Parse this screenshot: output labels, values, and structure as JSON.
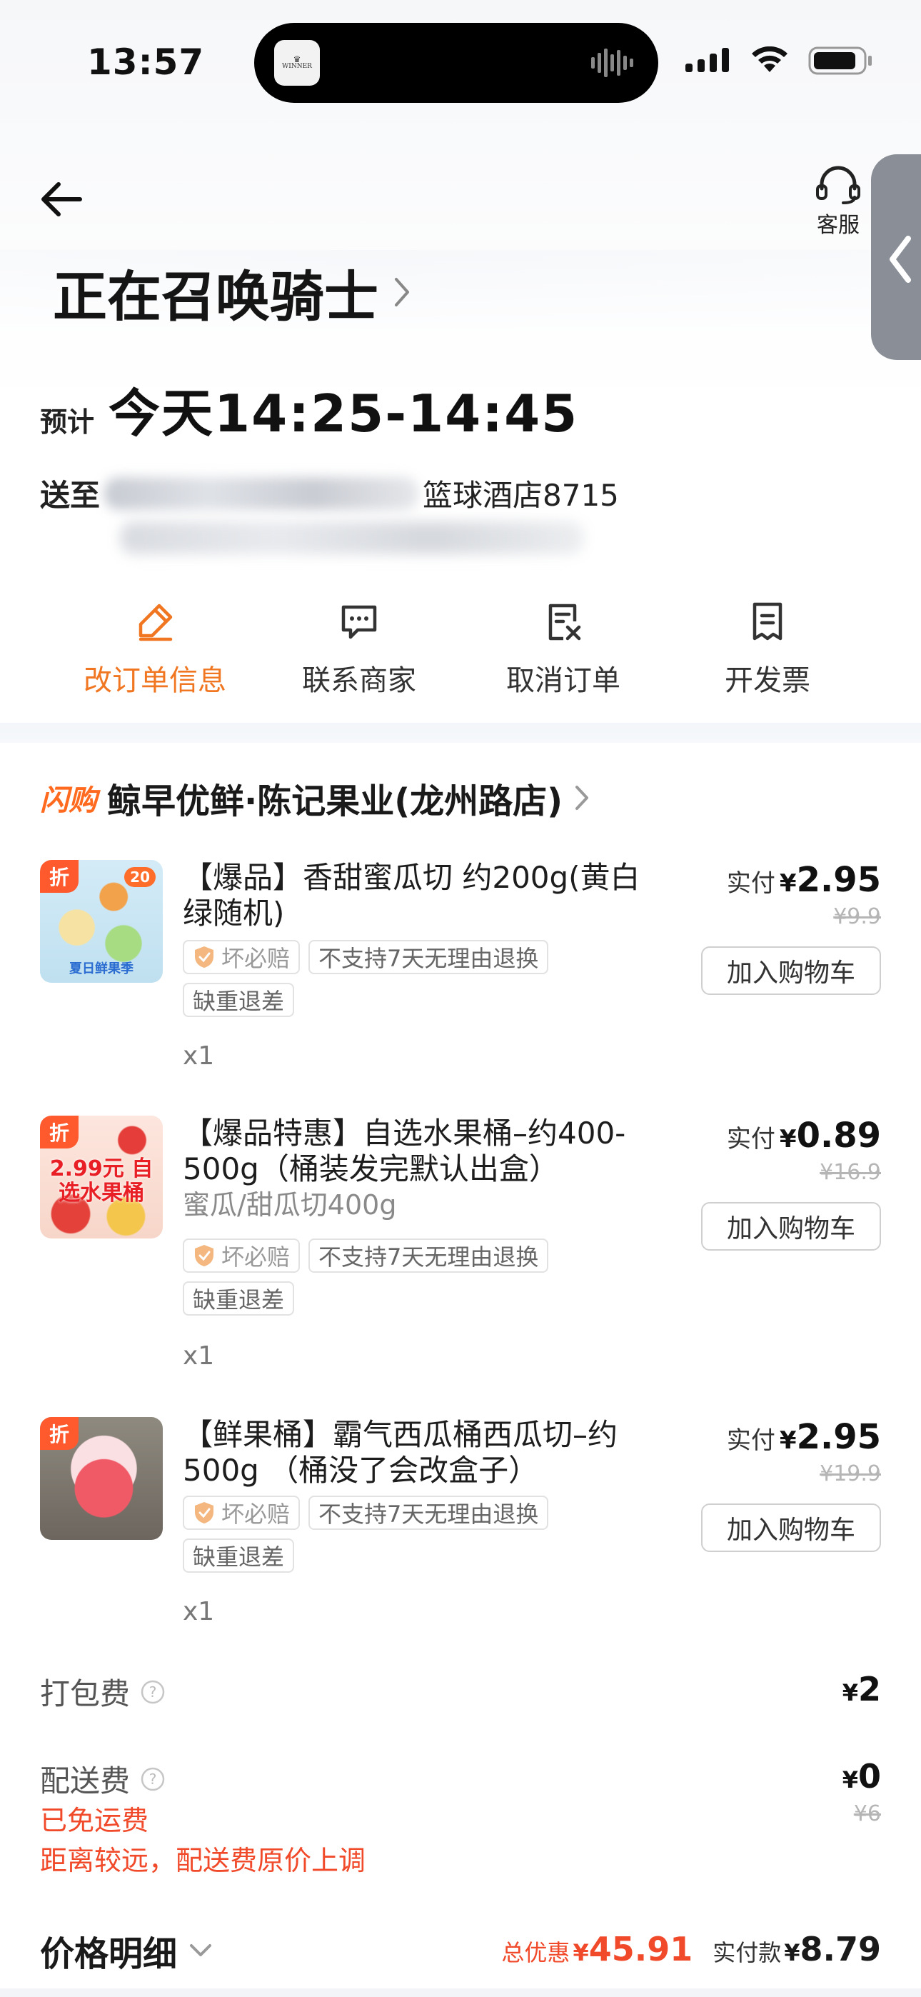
{
  "status_bar": {
    "time": "13:57",
    "island_app_label": "WINNER"
  },
  "nav": {
    "back_icon": "arrow-left-icon",
    "customer_service_label": "客服"
  },
  "order_status": {
    "title": "正在召唤骑士"
  },
  "eta": {
    "label": "预计",
    "time": "今天14:25-14:45"
  },
  "address": {
    "label": "送至",
    "visible_text": "篮球酒店8715"
  },
  "actions": [
    {
      "label": "改订单信息",
      "icon": "edit-icon",
      "active": true
    },
    {
      "label": "联系商家",
      "icon": "chat-icon",
      "active": false
    },
    {
      "label": "取消订单",
      "icon": "cancel-order-icon",
      "active": false
    },
    {
      "label": "开发票",
      "icon": "invoice-icon",
      "active": false
    }
  ],
  "shop": {
    "badge": "闪购",
    "name": "鲸早优鲜·陈记果业(龙州路店)"
  },
  "items": [
    {
      "thumb_tag": "折",
      "thumb_badge": "20",
      "thumb_text": "夏日鲜果季",
      "title": "【爆品】香甜蜜瓜切 约200g(黄白绿随机)",
      "spec": "",
      "tags": [
        "坏必赔",
        "不支持7天无理由退换",
        "缺重退差"
      ],
      "qty": "x1",
      "price_label": "实付",
      "currency": "¥",
      "price": "2.95",
      "original_price": "¥9.9",
      "cart_button": "加入购物车"
    },
    {
      "thumb_tag": "折",
      "thumb_badge": "",
      "thumb_text": "2.99元 自选水果桶",
      "title": "【爆品特惠】自选水果桶–约400-500g（桶装发完默认出盒）",
      "spec": "蜜瓜/甜瓜切400g",
      "tags": [
        "坏必赔",
        "不支持7天无理由退换",
        "缺重退差"
      ],
      "qty": "x1",
      "price_label": "实付",
      "currency": "¥",
      "price": "0.89",
      "original_price": "¥16.9",
      "cart_button": "加入购物车"
    },
    {
      "thumb_tag": "折",
      "thumb_badge": "",
      "thumb_text": "",
      "title": "【鲜果桶】霸气西瓜桶西瓜切–约500g （桶没了会改盒子）",
      "spec": "",
      "tags": [
        "坏必赔",
        "不支持7天无理由退换",
        "缺重退差"
      ],
      "qty": "x1",
      "price_label": "实付",
      "currency": "¥",
      "price": "2.95",
      "original_price": "¥19.9",
      "cart_button": "加入购物车"
    }
  ],
  "fees": {
    "packing": {
      "label": "打包费",
      "currency": "¥",
      "value": "2"
    },
    "delivery": {
      "label": "配送费",
      "currency": "¥",
      "value": "0",
      "original": "¥6",
      "note1": "已免运费",
      "note2": "距离较远，配送费原价上调"
    }
  },
  "summary": {
    "title": "价格明细",
    "discount_label": "总优惠",
    "currency": "¥",
    "discount_value": "45.91",
    "paid_label": "实付款",
    "paid_value": "8.79"
  },
  "colors": {
    "accent": "#f07621",
    "discount": "#f04a2b",
    "flash_badge": "#ff6a1f"
  }
}
